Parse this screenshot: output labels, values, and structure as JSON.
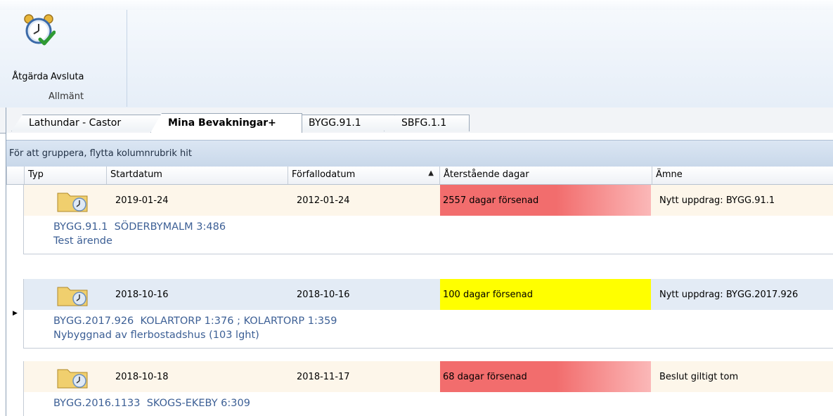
{
  "ribbon": {
    "atgarda_label": "Åtgärda",
    "avsluta_label": "Avsluta",
    "group_label": "Allmänt"
  },
  "tabs": [
    {
      "label": "Lathundar - Castor"
    },
    {
      "label": "Mina Bevakningar+"
    },
    {
      "label": "BYGG.91.1"
    },
    {
      "label": "SBFG.1.1"
    }
  ],
  "grid": {
    "group_hint": "För att gruppera, flytta kolumnrubrik hit",
    "columns": [
      "Typ",
      "Startdatum",
      "Förfallodatum",
      "Återstående dagar",
      "Ämne"
    ],
    "sort_indicator": "▲",
    "rows": [
      {
        "start": "2019-01-24",
        "due": "2012-01-24",
        "remaining": "2557 dagar försenad",
        "remaining_color": "#f26d6d",
        "subject": "Nytt uppdrag: BYGG.91.1",
        "preview1": "BYGG.91.1  SÖDERBYMALM 3:486",
        "preview2": "Test ärende"
      },
      {
        "start": "2018-10-16",
        "due": "2018-10-16",
        "remaining": "100 dagar försenad",
        "remaining_color": "#ffff00",
        "subject": "Nytt uppdrag: BYGG.2017.926",
        "preview1": "BYGG.2017.926  KOLARTORP 1:376 ; KOLARTORP 1:359",
        "preview2": "Nybyggnad av flerbostadshus (103 lght)"
      },
      {
        "start": "2018-10-18",
        "due": "2018-11-17",
        "remaining": "68 dagar försenad",
        "remaining_color": "#f26d6d",
        "subject": "Beslut giltigt tom",
        "preview1": "BYGG.2016.1133  SKOGS-EKEBY 6:309",
        "preview2": ""
      }
    ]
  },
  "colors": {
    "row_bg_1": "#fdf6ea",
    "row_bg_2": "#e3ebf5",
    "preview_text": "#3c5f95"
  }
}
